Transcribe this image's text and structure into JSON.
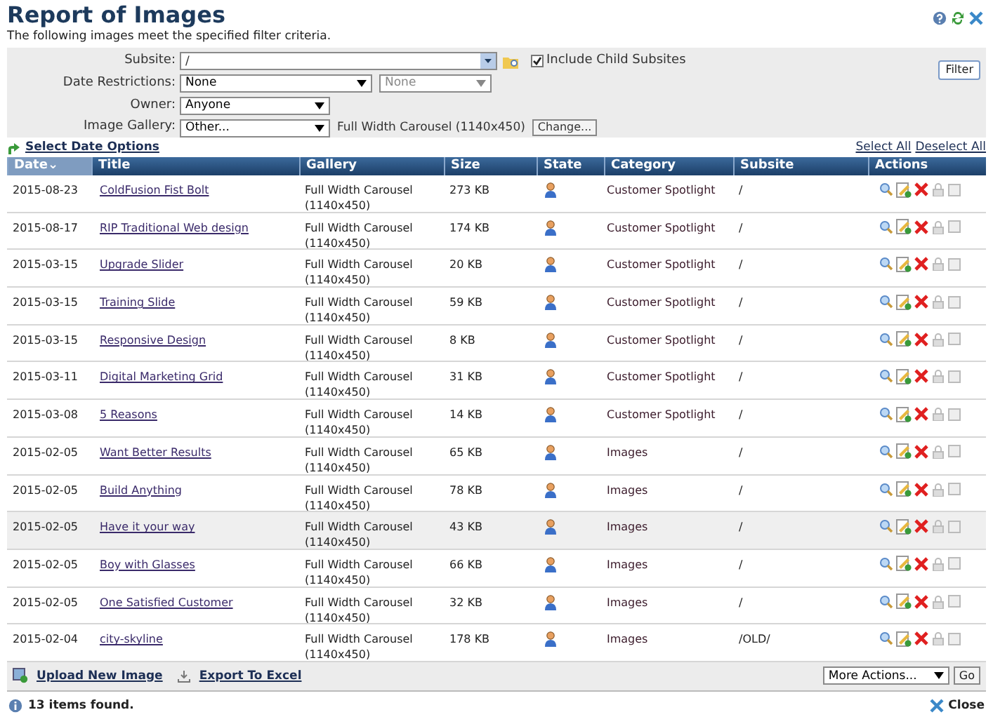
{
  "header": {
    "title": "Report of Images",
    "subtitle": "The following images meet the specified filter criteria."
  },
  "filters": {
    "subsite": {
      "label": "Subsite:",
      "value": "/",
      "include_child": {
        "label": "Include Child Subsites",
        "checked": true
      }
    },
    "date_restrictions": {
      "label": "Date Restrictions:",
      "value": "None",
      "second_value": "None"
    },
    "owner": {
      "label": "Owner:",
      "value": "Anyone"
    },
    "image_gallery": {
      "label": "Image Gallery:",
      "value": "Other...",
      "selection": "Full Width Carousel (1140x450)",
      "change_button": "Change..."
    },
    "filter_button": "Filter"
  },
  "select_date_options": "Select Date Options",
  "select_all": "Select All",
  "deselect_all": "Deselect All",
  "table": {
    "columns": [
      {
        "label": "Date",
        "sorted": true
      },
      {
        "label": "Title",
        "sorted": false
      },
      {
        "label": "Gallery",
        "sorted": false
      },
      {
        "label": "Size",
        "sorted": false
      },
      {
        "label": "State",
        "sorted": false
      },
      {
        "label": "Category",
        "sorted": false
      },
      {
        "label": "Subsite",
        "sorted": false
      },
      {
        "label": "Actions",
        "sorted": false
      }
    ],
    "sort_mark": "⌄",
    "rows": [
      {
        "date": "2015-08-23",
        "title": "ColdFusion Fist Bolt",
        "gallery": "Full Width Carousel (1140x450)",
        "size": "273 KB",
        "category": "Customer Spotlight",
        "subsite": "/",
        "highlighted": false,
        "checked": false
      },
      {
        "date": "2015-08-17",
        "title": "RIP Traditional Web design",
        "gallery": "Full Width Carousel (1140x450)",
        "size": "174 KB",
        "category": "Customer Spotlight",
        "subsite": "/",
        "highlighted": false,
        "checked": false
      },
      {
        "date": "2015-03-15",
        "title": "Upgrade Slider",
        "gallery": "Full Width Carousel (1140x450)",
        "size": "20 KB",
        "category": "Customer Spotlight",
        "subsite": "/",
        "highlighted": false,
        "checked": false
      },
      {
        "date": "2015-03-15",
        "title": "Training Slide",
        "gallery": "Full Width Carousel (1140x450)",
        "size": "59 KB",
        "category": "Customer Spotlight",
        "subsite": "/",
        "highlighted": false,
        "checked": false
      },
      {
        "date": "2015-03-15",
        "title": "Responsive Design",
        "gallery": "Full Width Carousel (1140x450)",
        "size": "8 KB",
        "category": "Customer Spotlight",
        "subsite": "/",
        "highlighted": false,
        "checked": false
      },
      {
        "date": "2015-03-11",
        "title": "Digital Marketing Grid",
        "gallery": "Full Width Carousel (1140x450)",
        "size": "31 KB",
        "category": "Customer Spotlight",
        "subsite": "/",
        "highlighted": false,
        "checked": false
      },
      {
        "date": "2015-03-08",
        "title": "5 Reasons",
        "gallery": "Full Width Carousel (1140x450)",
        "size": "14 KB",
        "category": "Customer Spotlight",
        "subsite": "/",
        "highlighted": false,
        "checked": false
      },
      {
        "date": "2015-02-05",
        "title": "Want Better Results",
        "gallery": "Full Width Carousel (1140x450)",
        "size": "65 KB",
        "category": "Images",
        "subsite": "/",
        "highlighted": false,
        "checked": false
      },
      {
        "date": "2015-02-05",
        "title": "Build Anything",
        "gallery": "Full Width Carousel (1140x450)",
        "size": "78 KB",
        "category": "Images",
        "subsite": "/",
        "highlighted": false,
        "checked": false
      },
      {
        "date": "2015-02-05",
        "title": "Have it your way",
        "gallery": "Full Width Carousel (1140x450)",
        "size": "43 KB",
        "category": "Images",
        "subsite": "/",
        "highlighted": true,
        "checked": false
      },
      {
        "date": "2015-02-05",
        "title": "Boy with Glasses",
        "gallery": "Full Width Carousel (1140x450)",
        "size": "66 KB",
        "category": "Images",
        "subsite": "/",
        "highlighted": false,
        "checked": false
      },
      {
        "date": "2015-02-05",
        "title": "One Satisfied Customer",
        "gallery": "Full Width Carousel (1140x450)",
        "size": "32 KB",
        "category": "Images",
        "subsite": "/",
        "highlighted": false,
        "checked": false
      },
      {
        "date": "2015-02-04",
        "title": "city-skyline",
        "gallery": "Full Width Carousel (1140x450)",
        "size": "178 KB",
        "category": "Images",
        "subsite": "/OLD/",
        "highlighted": false,
        "checked": false
      }
    ]
  },
  "footer": {
    "upload": "Upload New Image",
    "export": "Export To Excel",
    "more_actions": "More Actions...",
    "go": "Go"
  },
  "status": {
    "count": "13 items found.",
    "close": "Close"
  }
}
